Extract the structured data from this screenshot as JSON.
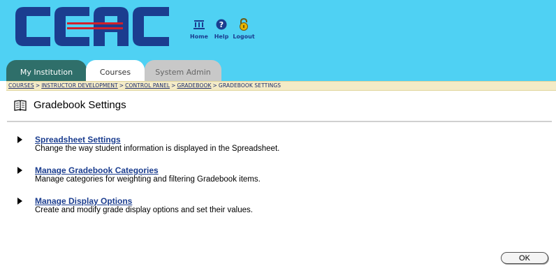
{
  "brand": {
    "logo_text": "CCAC",
    "colors": {
      "header_bg": "#4fd1f3",
      "logo_blue": "#1b3d8f",
      "logo_red": "#d0202a",
      "link": "#1b3d8f",
      "crumb_bg": "#f4ebc6"
    }
  },
  "toplinks": [
    {
      "label": "Home",
      "icon": "home-building-icon"
    },
    {
      "label": "Help",
      "icon": "help-circle-icon"
    },
    {
      "label": "Logout",
      "icon": "padlock-icon"
    }
  ],
  "tabs": [
    {
      "label": "My Institution",
      "state": "inactive"
    },
    {
      "label": "Courses",
      "state": "active"
    },
    {
      "label": "System Admin",
      "state": "inactive"
    }
  ],
  "breadcrumb": {
    "items": [
      "COURSES",
      "INSTRUCTOR DEVELOPMENT",
      "CONTROL PANEL",
      "GRADEBOOK"
    ],
    "current": "GRADEBOOK SETTINGS",
    "separator": ">"
  },
  "page": {
    "title": "Gradebook Settings",
    "title_icon": "open-book-icon"
  },
  "options": [
    {
      "label": "Spreadsheet Settings",
      "description": "Change the way student information is displayed in the Spreadsheet."
    },
    {
      "label": "Manage Gradebook Categories",
      "description": "Manage categories for weighting and filtering Gradebook items."
    },
    {
      "label": "Manage Display Options",
      "description": "Create and modify grade display options and set their values."
    }
  ],
  "footer": {
    "ok_label": "OK"
  }
}
